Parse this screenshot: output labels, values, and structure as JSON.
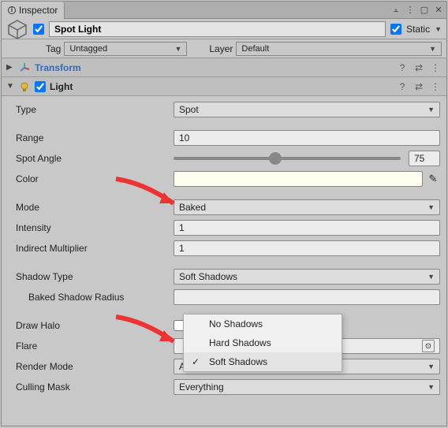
{
  "tab": {
    "title": "Inspector"
  },
  "header": {
    "name": "Spot Light",
    "static_label": "Static",
    "tag_label": "Tag",
    "tag_value": "Untagged",
    "layer_label": "Layer",
    "layer_value": "Default"
  },
  "components": {
    "transform": {
      "name": "Transform"
    },
    "light": {
      "name": "Light",
      "type_label": "Type",
      "type_value": "Spot",
      "range_label": "Range",
      "range_value": "10",
      "spotangle_label": "Spot Angle",
      "spotangle_value": "75",
      "color_label": "Color",
      "mode_label": "Mode",
      "mode_value": "Baked",
      "intensity_label": "Intensity",
      "intensity_value": "1",
      "indirect_label": "Indirect Multiplier",
      "indirect_value": "1",
      "shadowtype_label": "Shadow Type",
      "shadowtype_value": "Soft Shadows",
      "bakedshadowradius_label": "Baked Shadow Radius",
      "drawhalo_label": "Draw Halo",
      "flare_label": "Flare",
      "flare_value": "",
      "rendermode_label": "Render Mode",
      "rendermode_value": "Auto",
      "cullingmask_label": "Culling Mask",
      "cullingmask_value": "Everything",
      "shadow_options": {
        "none": "No Shadows",
        "hard": "Hard Shadows",
        "soft": "Soft Shadows"
      }
    }
  }
}
